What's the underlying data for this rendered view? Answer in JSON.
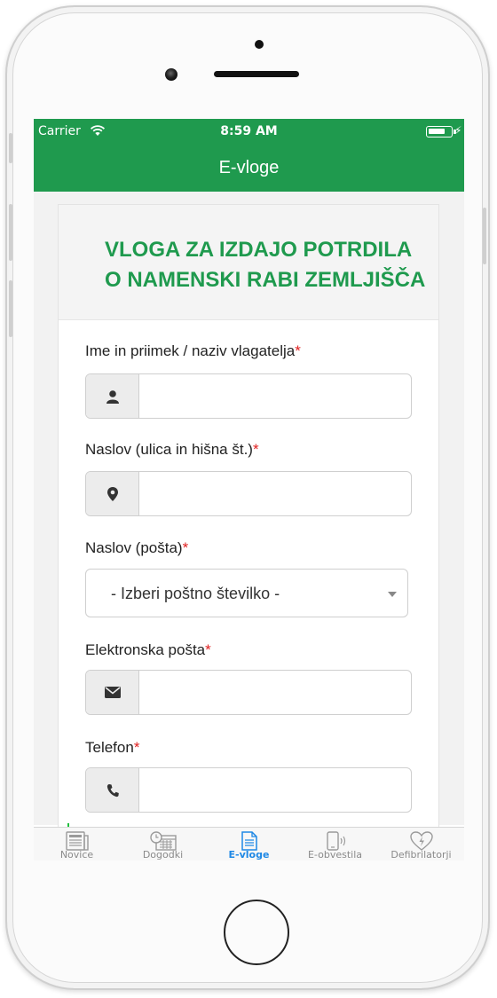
{
  "status_bar": {
    "carrier": "Carrier",
    "time": "8:59 AM"
  },
  "nav": {
    "title": "E-vloge"
  },
  "form": {
    "title_line1": "VLOGA ZA IZDAJO POTRDILA",
    "title_line2": "O NAMENSKI RABI ZEMLJIŠČA",
    "required_mark": "*",
    "fields": [
      {
        "label": "Ime in priimek / naziv vlagatelja",
        "icon": "user-icon",
        "value": ""
      },
      {
        "label": "Naslov (ulica in hišna št.)",
        "icon": "map-marker-icon",
        "value": ""
      },
      {
        "label": "Naslov (pošta)",
        "select_value": "- Izberi poštno številko -"
      },
      {
        "label": "Elektronska pošta",
        "icon": "envelope-icon",
        "value": ""
      },
      {
        "label": "Telefon",
        "icon": "phone-icon",
        "value": ""
      }
    ]
  },
  "tabbar": {
    "tabs": [
      {
        "label": "Novice",
        "icon": "newspaper-icon",
        "active": false
      },
      {
        "label": "Dogodki",
        "icon": "calendar-clock-icon",
        "active": false
      },
      {
        "label": "E-vloge",
        "icon": "document-icon",
        "active": true
      },
      {
        "label": "E-obvestila",
        "icon": "phone-vibrate-icon",
        "active": false
      },
      {
        "label": "Defibrilatorji",
        "icon": "heart-bolt-icon",
        "active": false
      }
    ]
  },
  "colors": {
    "brand_green": "#1f9a4e",
    "required_red": "#e02020",
    "tab_active_blue": "#1e88e5"
  }
}
